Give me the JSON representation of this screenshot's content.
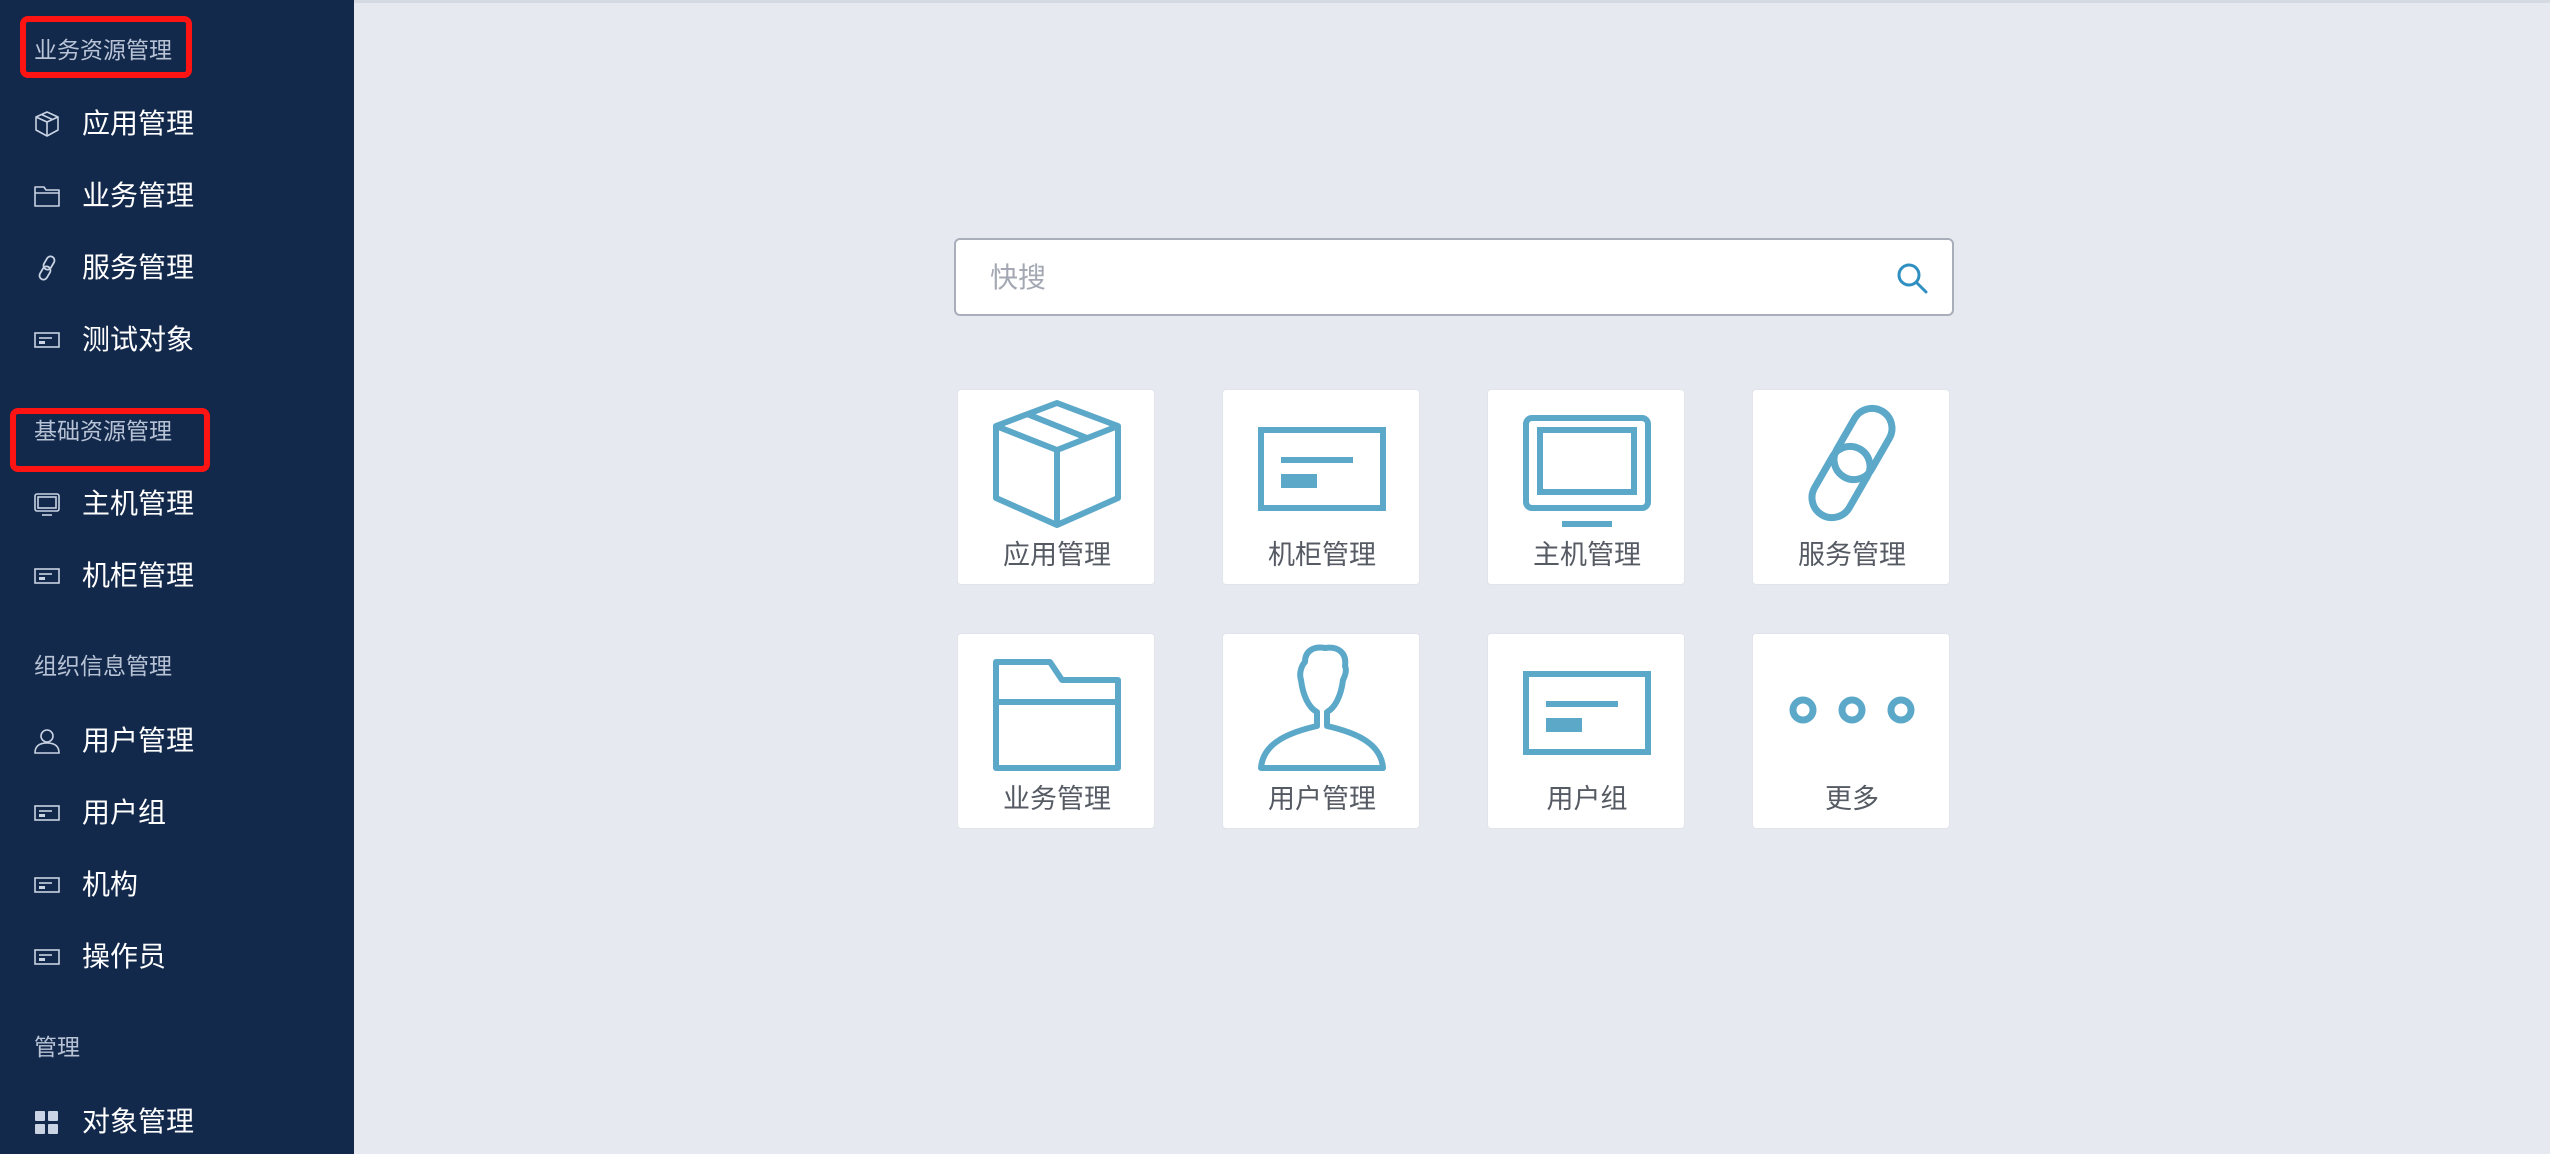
{
  "sidebar": {
    "sections": [
      {
        "title": "业务资源管理",
        "items": [
          {
            "label": "应用管理",
            "icon": "cube-icon"
          },
          {
            "label": "业务管理",
            "icon": "folder-icon"
          },
          {
            "label": "服务管理",
            "icon": "link-icon"
          },
          {
            "label": "测试对象",
            "icon": "card-icon"
          }
        ]
      },
      {
        "title": "基础资源管理",
        "items": [
          {
            "label": "主机管理",
            "icon": "monitor-icon"
          },
          {
            "label": "机柜管理",
            "icon": "card-icon"
          }
        ]
      },
      {
        "title": "组织信息管理",
        "items": [
          {
            "label": "用户管理",
            "icon": "user-icon"
          },
          {
            "label": "用户组",
            "icon": "card-icon"
          },
          {
            "label": "机构",
            "icon": "card-icon"
          },
          {
            "label": "操作员",
            "icon": "card-icon"
          }
        ]
      },
      {
        "title": "管理",
        "items": [
          {
            "label": "对象管理",
            "icon": "grid-icon"
          }
        ]
      }
    ]
  },
  "search": {
    "placeholder": "快搜",
    "value": ""
  },
  "tiles": [
    {
      "label": "应用管理",
      "icon": "cube-icon"
    },
    {
      "label": "机柜管理",
      "icon": "card-icon"
    },
    {
      "label": "主机管理",
      "icon": "monitor-icon"
    },
    {
      "label": "服务管理",
      "icon": "link-icon"
    },
    {
      "label": "业务管理",
      "icon": "folder-icon"
    },
    {
      "label": "用户管理",
      "icon": "user-icon"
    },
    {
      "label": "用户组",
      "icon": "card-icon"
    },
    {
      "label": "更多",
      "icon": "more-icon"
    }
  ],
  "colors": {
    "sidebar_bg": "#13294b",
    "main_bg": "#e6e9f0",
    "accent": "#5ba8c9",
    "highlight": "#ff1414"
  }
}
